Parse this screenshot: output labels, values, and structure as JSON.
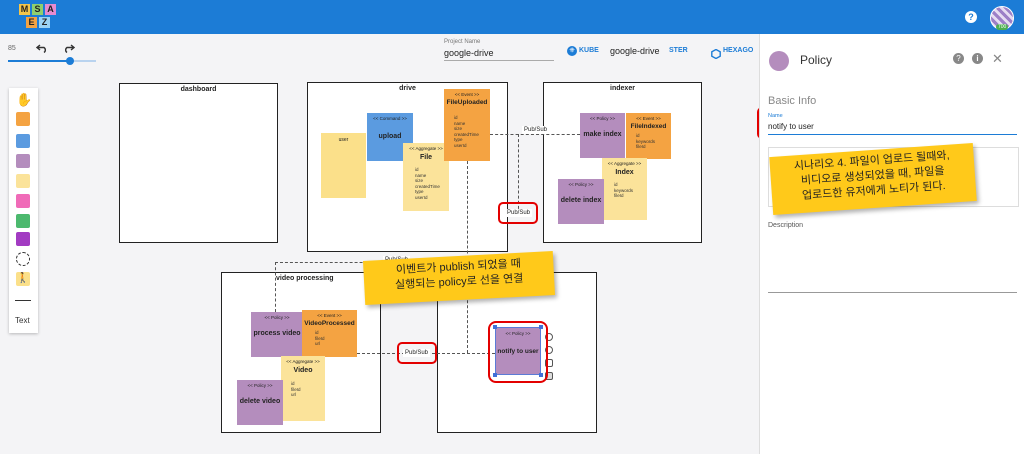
{
  "logo": {
    "letters": [
      "M",
      "S",
      "A",
      "E",
      "Z"
    ]
  },
  "header": {
    "badge": "700"
  },
  "zoom": {
    "value": "85",
    "fraction": 0.7
  },
  "project": {
    "label": "Project Name",
    "name": "google-drive"
  },
  "deploy": {
    "kube_label": "KUBE",
    "kube_project": "google-drive",
    "ster_label": "STER",
    "hex_label": "HEXAGO"
  },
  "palette": {
    "line_label": "",
    "text_label": "Text"
  },
  "diagram": {
    "dashboard": {
      "title": "dashboard"
    },
    "drive": {
      "title": "drive",
      "user_actor": {
        "name": "user"
      },
      "upload_cmd": {
        "stereotype": "<< Command >>",
        "name": "upload"
      },
      "file_agg": {
        "stereotype": "<< Aggregate >>",
        "name": "File",
        "attrs": [
          "id",
          "name",
          "size",
          "createdTime",
          "type",
          "userId"
        ]
      },
      "file_uploaded": {
        "stereotype": "<< Event >>",
        "name": "FileUploaded",
        "attrs": [
          "id",
          "name",
          "size",
          "createdTime",
          "type",
          "userId"
        ]
      }
    },
    "indexer": {
      "title": "indexer",
      "make_index": {
        "stereotype": "<< Policy >>",
        "name": "make index"
      },
      "file_indexed": {
        "stereotype": "<< Event >>",
        "name": "FileIndexed",
        "attrs": [
          "id",
          "keywords",
          "fileId"
        ]
      },
      "index_agg": {
        "stereotype": "<< Aggregate >>",
        "name": "Index",
        "attrs": [
          "id",
          "keywords",
          "fileId"
        ]
      },
      "delete_index": {
        "stereotype": "<< Policy >>",
        "name": "delete index"
      }
    },
    "video": {
      "title": "video processing",
      "process_video": {
        "stereotype": "<< Policy >>",
        "name": "process video"
      },
      "video_processed": {
        "stereotype": "<< Event >>",
        "name": "VideoProcessed",
        "attrs": [
          "id",
          "fileId",
          "url"
        ]
      },
      "video_agg": {
        "stereotype": "<< Aggregate >>",
        "name": "Video",
        "attrs": [
          "id",
          "fileId",
          "url"
        ]
      },
      "delete_video": {
        "stereotype": "<< Policy >>",
        "name": "delete video"
      }
    },
    "notification": {
      "notify": {
        "stereotype": "<< Policy >>",
        "name": "notify to user"
      }
    },
    "pubsub": {
      "label1": "Pub/Sub",
      "label2": "Pub/Sub",
      "label3": "Pub/Sub",
      "label4": "Pub/Sub"
    }
  },
  "annotations": {
    "callout_policy": {
      "line1": "이벤트가 publish 되었을 때",
      "line2": "실행되는 policy로 선을 연결"
    },
    "callout_scenario": {
      "line1": "시나리오 4. 파일이 업로드 될때와,",
      "line2": "비디오로 생성되었을 때, 파일을",
      "line3": "업로드한 유저에게 노티가 된다."
    }
  },
  "side_panel": {
    "title": "Policy",
    "section": "Basic Info",
    "name_label": "Name",
    "name_value": "notify to user",
    "description_label": "Description"
  },
  "colors": {
    "primary": "#1c7cd6",
    "policy": "#b48dbd",
    "event": "#f4a342",
    "command": "#5b9be0",
    "aggregate": "#fbe39a",
    "actor": "#fbe08a",
    "annotation": "#ffc91a",
    "highlight": "#e30000"
  }
}
